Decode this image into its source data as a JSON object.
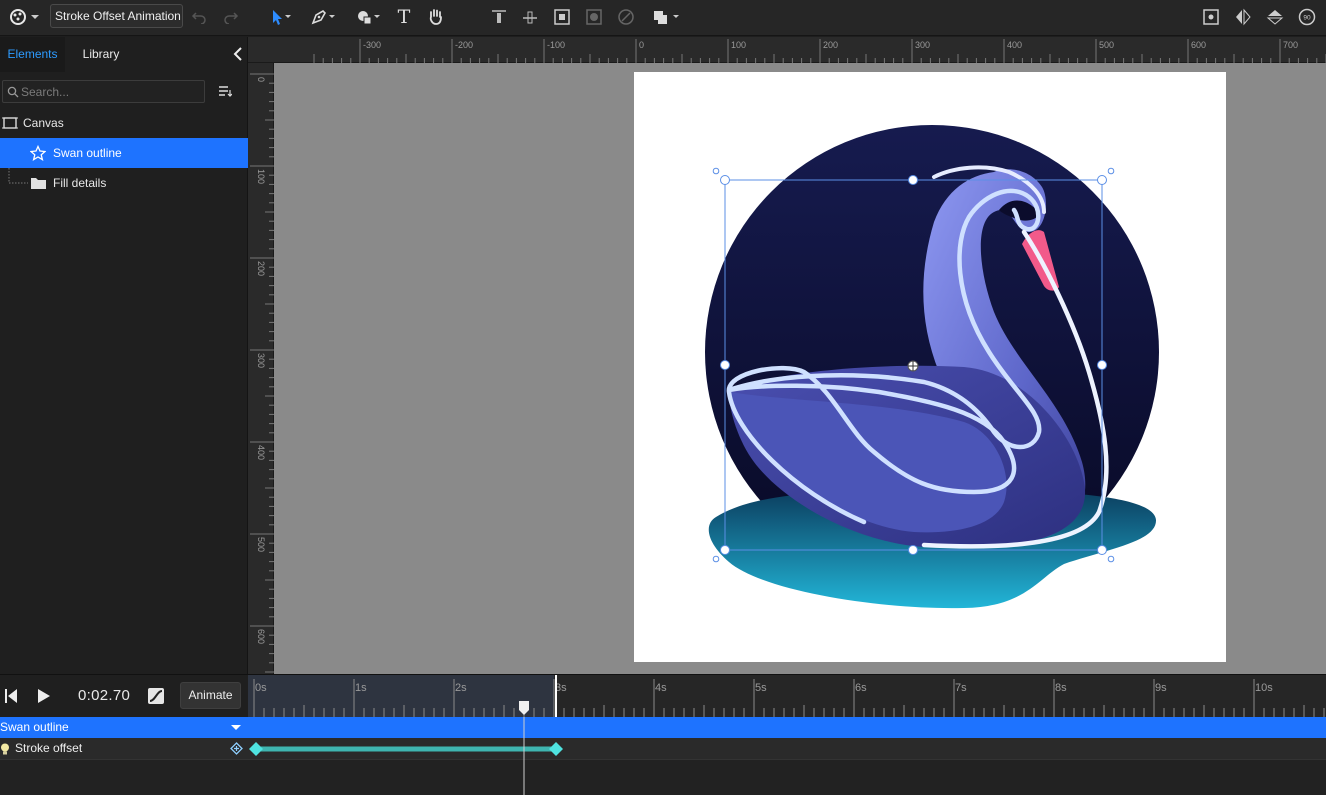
{
  "toolbar": {
    "document_title": "Stroke Offset Animation",
    "tools": [
      "select-tool",
      "pen-tool",
      "shape-tool",
      "text-tool",
      "hand-tool"
    ],
    "text_tool_glyph": "T"
  },
  "left_panel": {
    "tabs": [
      {
        "label": "Elements",
        "active": true
      },
      {
        "label": "Library",
        "active": false
      }
    ],
    "search_placeholder": "Search...",
    "layers": [
      {
        "label": "Canvas",
        "icon": "artboard-icon",
        "selected": false
      },
      {
        "label": "Swan outline",
        "icon": "star-outline-icon",
        "selected": true
      },
      {
        "label": "Fill details",
        "icon": "folder-icon",
        "selected": false
      }
    ]
  },
  "rulers": {
    "horizontal_labels": [
      "-300",
      "-200",
      "-100",
      "0",
      "100",
      "200",
      "300",
      "400",
      "500",
      "600",
      "700"
    ],
    "vertical_labels": [
      "0",
      "100",
      "200",
      "300",
      "400",
      "500",
      "600"
    ]
  },
  "timeline": {
    "current_time": "0:02.70",
    "animate_label": "Animate",
    "time_labels": [
      "0s",
      "1s",
      "2s",
      "3s",
      "4s",
      "5s",
      "6s",
      "7s",
      "8s",
      "9s",
      "10s"
    ],
    "playhead_seconds": 2.7,
    "track": "Swan outline",
    "property": "Stroke offset",
    "keyframes_seconds": [
      0,
      3
    ]
  },
  "colors": {
    "accent": "#1e73ff",
    "selection": "#5b8fe6",
    "keyframe": "#4fe3e0",
    "night_sky_top": "#161b4f",
    "night_sky_bottom": "#0a0b2a",
    "water": "#1fa6c9",
    "swan": "#6670d6",
    "beak": "#f25a8a"
  }
}
